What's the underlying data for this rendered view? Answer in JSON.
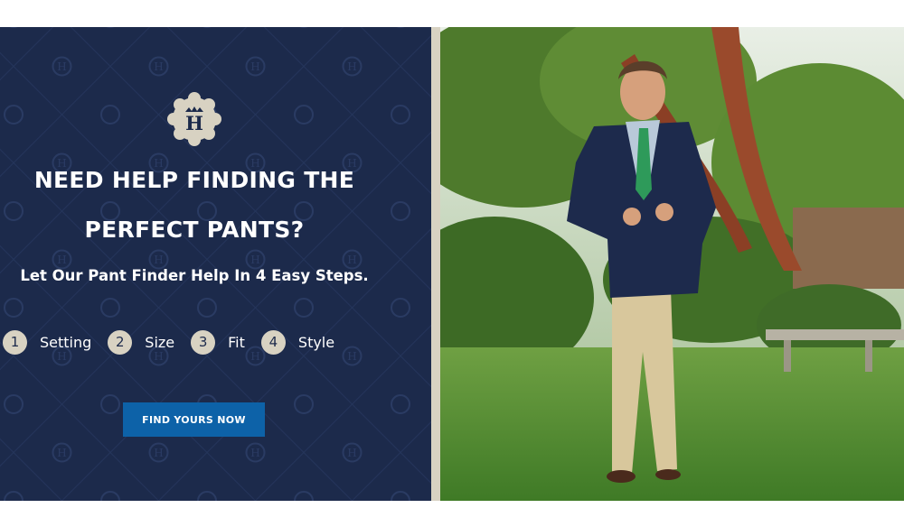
{
  "promo": {
    "logo_letter": "H",
    "headline_line1": "NEED HELP FINDING THE",
    "headline_line2": "PERFECT PANTS?",
    "subheadline": "Let Our Pant Finder Help In 4 Easy Steps.",
    "steps": [
      {
        "number": "1",
        "label": "Setting"
      },
      {
        "number": "2",
        "label": "Size"
      },
      {
        "number": "3",
        "label": "Fit"
      },
      {
        "number": "4",
        "label": "Style"
      }
    ],
    "cta_label": "FIND YOURS NOW"
  },
  "colors": {
    "navy_background": "#1c2a4b",
    "cream_accent": "#d8d2c2",
    "button_blue": "#0d62a8",
    "text_white": "#ffffff"
  }
}
